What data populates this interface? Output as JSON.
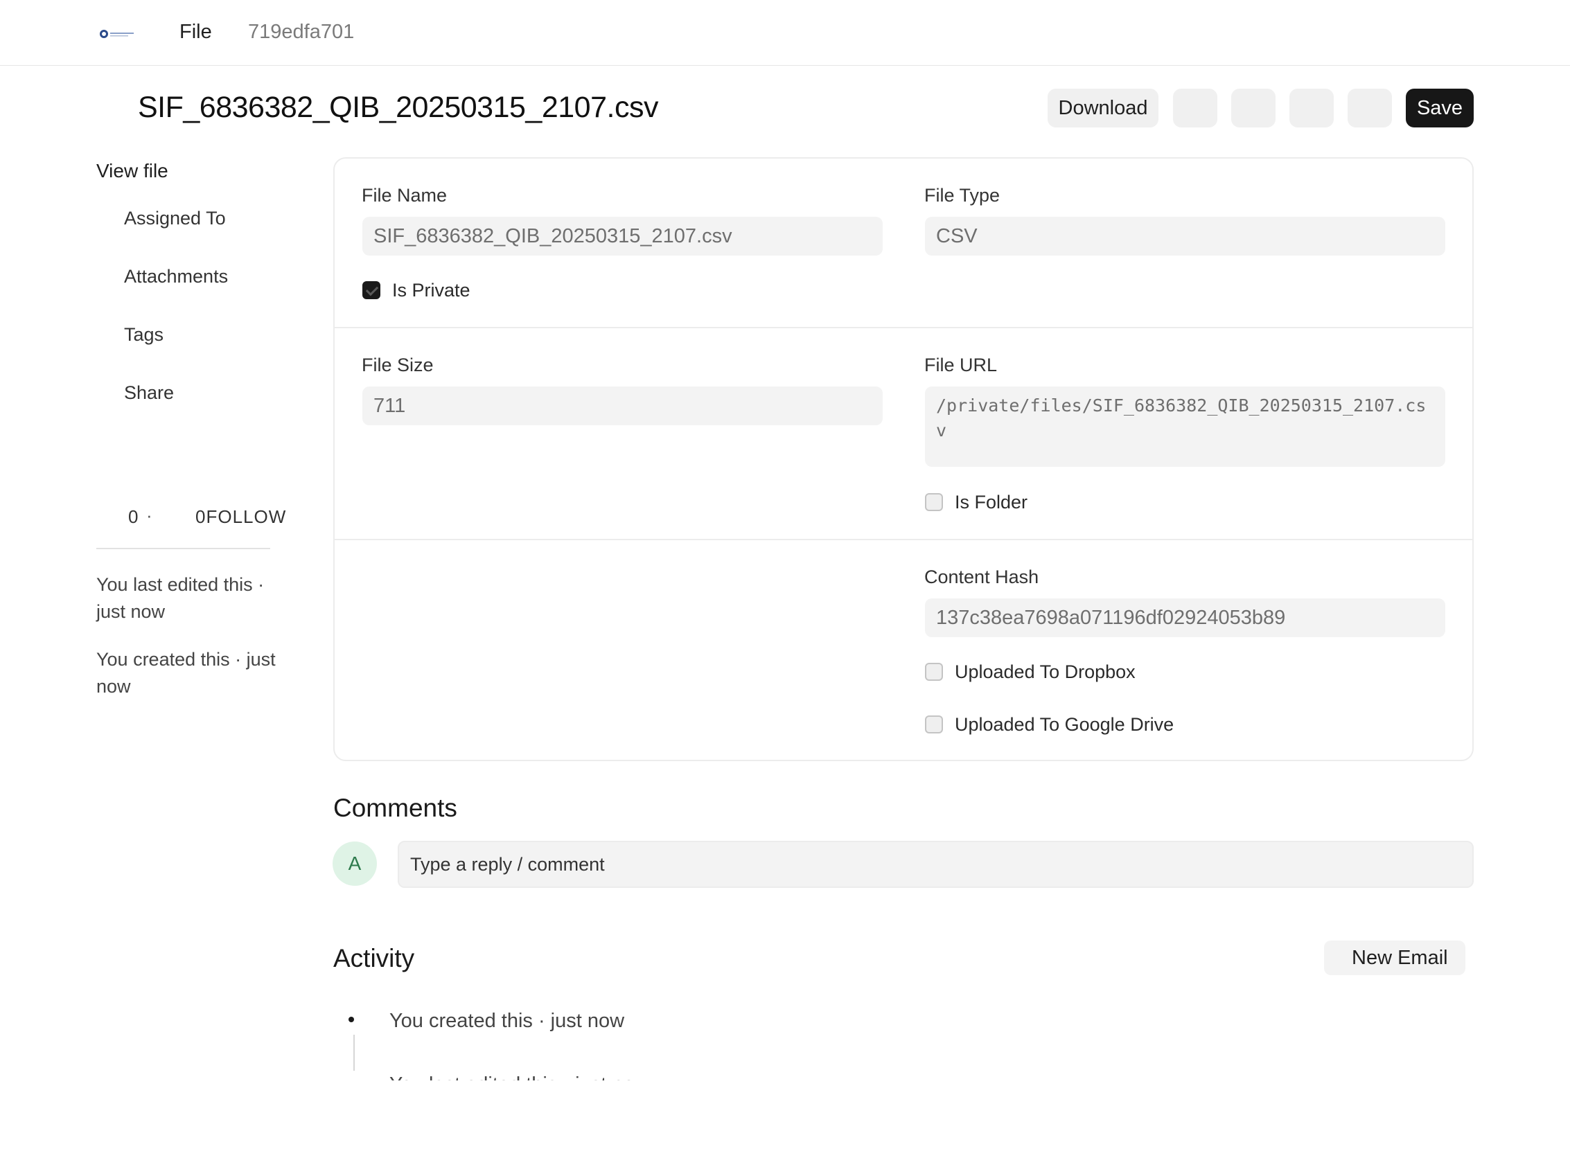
{
  "topbar": {
    "breadcrumb_file": "File",
    "breadcrumb_id": "719edfa701"
  },
  "header": {
    "title": "SIF_6836382_QIB_20250315_2107.csv",
    "download_label": "Download",
    "save_label": "Save"
  },
  "sidebar": {
    "title": "View file",
    "items": [
      "Assigned To",
      "Attachments",
      "Tags",
      "Share"
    ],
    "follow_count": "0",
    "follow_separator": "·",
    "follow_label": "0FOLLOW",
    "last_edited": "You last edited this · just now",
    "created": "You created this · just now"
  },
  "form": {
    "file_name_label": "File Name",
    "file_name_value": "SIF_6836382_QIB_20250315_2107.csv",
    "file_type_label": "File Type",
    "file_type_value": "CSV",
    "is_private_label": "Is Private",
    "is_private_checked": true,
    "file_size_label": "File Size",
    "file_size_value": "711",
    "file_url_label": "File URL",
    "file_url_value": "/private/files/SIF_6836382_QIB_20250315_2107.csv",
    "is_folder_label": "Is Folder",
    "is_folder_checked": false,
    "content_hash_label": "Content Hash",
    "content_hash_value": "137c38ea7698a071196df02924053b89",
    "dropbox_label": "Uploaded To Dropbox",
    "dropbox_checked": false,
    "gdrive_label": "Uploaded To Google Drive",
    "gdrive_checked": false
  },
  "comments": {
    "heading": "Comments",
    "avatar_initial": "A",
    "placeholder": "Type a reply / comment"
  },
  "activity": {
    "heading": "Activity",
    "new_email_label": "New Email",
    "items": [
      "You created this · just now",
      "You last edited this · just now"
    ]
  },
  "colors": {
    "primary_button": "#171717",
    "avatar_bg": "#dff3e6",
    "avatar_text": "#2d7a4c"
  }
}
